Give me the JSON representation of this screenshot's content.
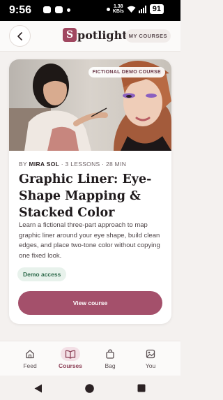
{
  "status": {
    "time": "9:56",
    "speed_value": "1.38",
    "speed_unit": "KB/s",
    "battery": "91"
  },
  "header": {
    "logo_letter": "S",
    "logo_text": "potlight",
    "my_courses": "MY COURSES"
  },
  "course": {
    "badge": "FICTIONAL DEMO COURSE",
    "byline_prefix": "BY ",
    "author": "MIRA SOL",
    "meta": " · 3 LESSONS · 28 MIN",
    "title": "Graphic Liner: Eye-Shape Mapping & Stacked Color",
    "description": "Learn a fictional three-part approach to map graphic liner around your eye shape, build clean edges, and place two-tone color without copying one fixed look.",
    "access": "Demo access",
    "cta": "View course"
  },
  "nav": [
    {
      "label": "Feed",
      "icon": "home-icon"
    },
    {
      "label": "Courses",
      "icon": "book-icon",
      "active": true
    },
    {
      "label": "Bag",
      "icon": "bag-icon"
    },
    {
      "label": "You",
      "icon": "image-icon"
    }
  ],
  "colors": {
    "accent": "#a4506b",
    "brand": "#a04760",
    "access_green": "#2f6b4c"
  }
}
